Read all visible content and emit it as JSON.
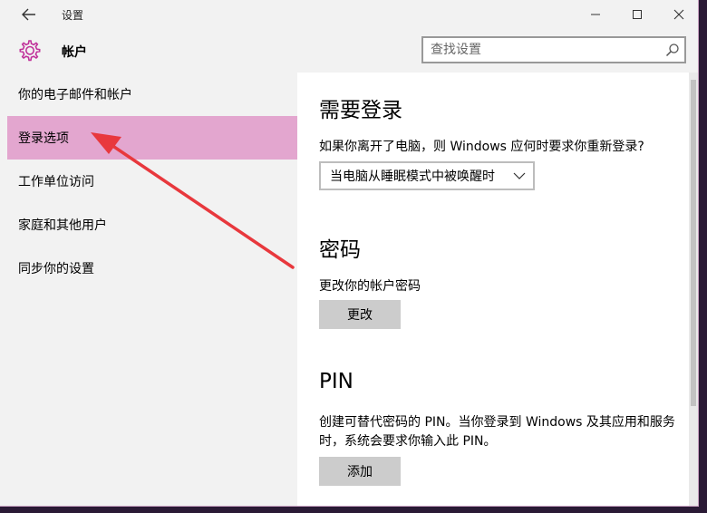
{
  "titlebar": {
    "title": "设置",
    "back_icon": "arrow-left-icon",
    "minimize_icon": "minimize-icon",
    "maximize_icon": "maximize-icon",
    "close_icon": "close-icon"
  },
  "header": {
    "icon": "gear-icon",
    "title": "帐户",
    "search": {
      "placeholder": "查找设置",
      "value": ""
    }
  },
  "sidebar": {
    "items": [
      {
        "label": "你的电子邮件和帐户"
      },
      {
        "label": "登录选项"
      },
      {
        "label": "工作单位访问"
      },
      {
        "label": "家庭和其他用户"
      },
      {
        "label": "同步你的设置"
      }
    ],
    "active_index": 1
  },
  "content": {
    "require_signin": {
      "heading": "需要登录",
      "question": "如果你离开了电脑，则 Windows 应何时要求你重新登录?",
      "dropdown_value": "当电脑从睡眠模式中被唤醒时"
    },
    "password": {
      "heading": "密码",
      "desc": "更改你的帐户密码",
      "button": "更改"
    },
    "pin": {
      "heading": "PIN",
      "desc": "创建可替代密码的 PIN。当你登录到 Windows 及其应用和服务时，系统会要求你输入此 PIN。",
      "button": "添加"
    }
  },
  "colors": {
    "accent": "#c0319a",
    "selected_bg": "#e3a6cf",
    "annotation_arrow": "#e8383d"
  }
}
